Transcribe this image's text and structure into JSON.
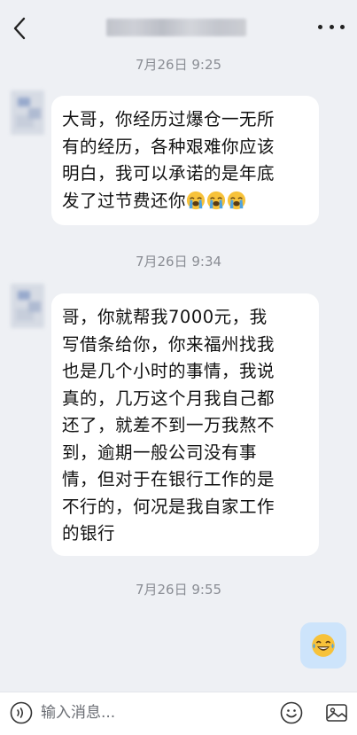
{
  "header": {
    "back_icon": "chevron-left-icon",
    "more_icon": "more-dots-icon"
  },
  "messages": [
    {
      "time": "7月26日 9:25",
      "lines": [
        "大哥，你经历过爆仓一无所",
        "有的经历，各种艰难你应该",
        "明白，我可以承诺的是年底",
        "发了过节费还你"
      ],
      "trailing_emojis": [
        "loudly-crying-face",
        "loudly-crying-face",
        "loudly-crying-face"
      ]
    },
    {
      "time": "7月26日 9:34",
      "lines": [
        "哥，你就帮我7000元，我",
        "写借条给你，你来福州找我",
        "也是几个小时的事情，我说",
        "真的，几万这个月我自己都",
        "还了，就差不到一万我熬不",
        "到，逾期一般公司没有事",
        "情，但对于在银行工作的是",
        "不行的，何况是我自家工作",
        "的银行"
      ]
    },
    {
      "time": "7月26日 9:55",
      "sent_emoji": "tears-of-joy-face"
    }
  ],
  "input_bar": {
    "placeholder": "输入消息...",
    "voice_icon": "voice-icon",
    "emoji_icon": "emoji-icon",
    "image_icon": "image-icon"
  },
  "colors": {
    "background": "#eef0f4",
    "bubble_received": "#ffffff",
    "bubble_sent": "#cde4fb",
    "timestamp": "#8a8d94"
  }
}
